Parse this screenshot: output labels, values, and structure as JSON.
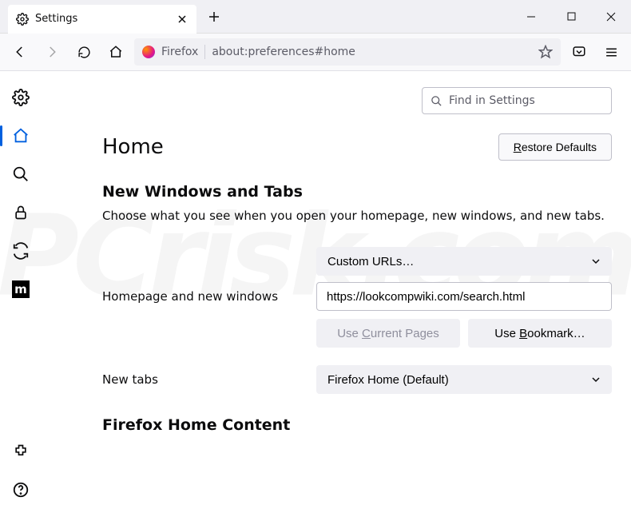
{
  "tab": {
    "title": "Settings"
  },
  "url": {
    "product": "Firefox",
    "path": "about:preferences#home"
  },
  "search": {
    "placeholder": "Find in Settings"
  },
  "header": {
    "title": "Home",
    "restore_label": "Restore Defaults"
  },
  "sections": {
    "nwt": {
      "title": "New Windows and Tabs",
      "desc": "Choose what you see when you open your homepage, new windows, and new tabs."
    },
    "homepage": {
      "label": "Homepage and new windows",
      "select": "Custom URLs…",
      "url_value": "https://lookcompwiki.com/search.html",
      "use_current": "Use Current Pages",
      "use_bookmark": "Use Bookmark…"
    },
    "newtabs": {
      "label": "New tabs",
      "select": "Firefox Home (Default)"
    },
    "fhc": {
      "title": "Firefox Home Content"
    }
  }
}
